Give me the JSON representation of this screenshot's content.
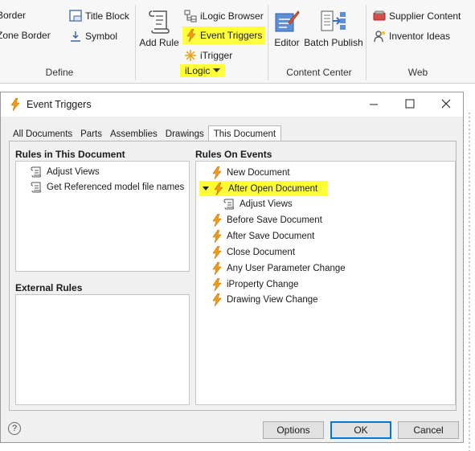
{
  "ribbon": {
    "define": {
      "border": "Border",
      "zone_border": "Zone Border",
      "title_block": "Title Block",
      "symbol": "Symbol",
      "label": "Define"
    },
    "ilogic": {
      "add_rule": "Add Rule",
      "browser": "iLogic Browser",
      "event_triggers": "Event Triggers",
      "itrigger": "iTrigger",
      "label": "iLogic"
    },
    "content_center": {
      "editor": "Editor",
      "batch_publish": "Batch Publish",
      "label": "Content Center"
    },
    "web": {
      "supplier_content": "Supplier Content",
      "inventor_ideas": "Inventor Ideas",
      "label": "Web"
    },
    "highlight_color": "#ffff3a"
  },
  "dialog": {
    "title": "Event Triggers",
    "tabs": [
      "All Documents",
      "Parts",
      "Assemblies",
      "Drawings",
      "This Document"
    ],
    "active_tab": "This Document",
    "rules_in_doc": {
      "label": "Rules in This Document",
      "items": [
        "Adjust Views",
        "Get Referenced model file names"
      ]
    },
    "external_rules": {
      "label": "External Rules",
      "items": []
    },
    "rules_on_events": {
      "label": "Rules On Events",
      "events": [
        {
          "name": "New Document"
        },
        {
          "name": "After Open Document",
          "expanded": true,
          "highlighted": true,
          "children": [
            "Adjust Views"
          ]
        },
        {
          "name": "Before Save Document"
        },
        {
          "name": "After Save Document"
        },
        {
          "name": "Close Document"
        },
        {
          "name": "Any User Parameter Change"
        },
        {
          "name": "iProperty Change"
        },
        {
          "name": "Drawing View Change"
        }
      ]
    },
    "buttons": {
      "options": "Options",
      "ok": "OK",
      "cancel": "Cancel"
    },
    "help_glyph": "?"
  }
}
